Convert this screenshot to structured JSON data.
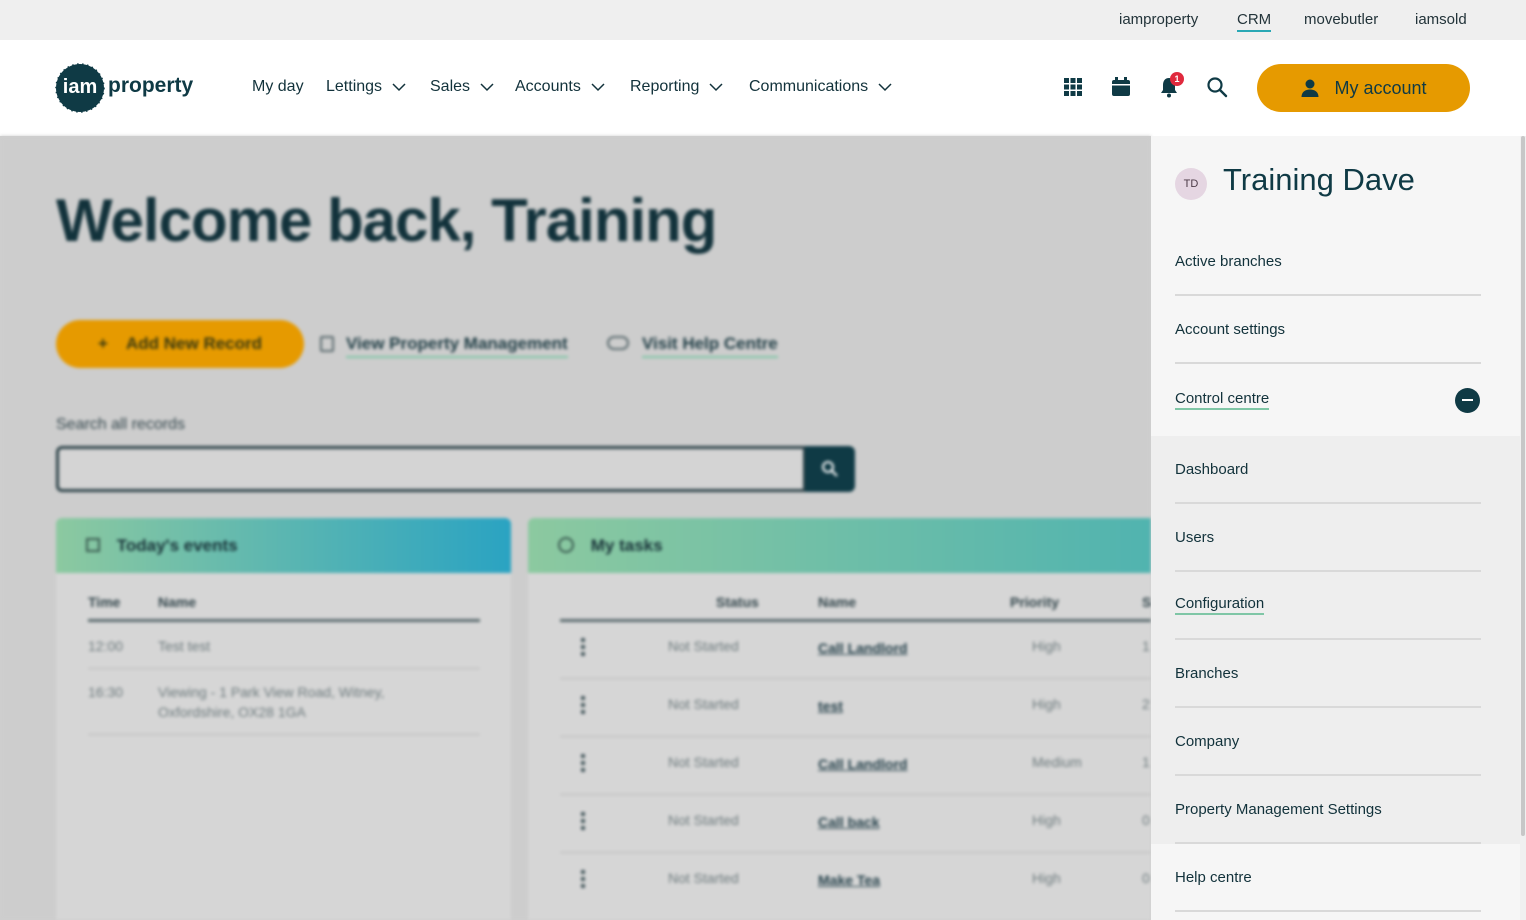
{
  "utility_links": [
    {
      "label": "iamproperty",
      "active": false
    },
    {
      "label": "CRM",
      "active": true
    },
    {
      "label": "movebutler",
      "active": false
    },
    {
      "label": "iamsold",
      "active": false
    }
  ],
  "logo": {
    "mark": "iam",
    "word": "property"
  },
  "nav": {
    "items": [
      {
        "label": "My day",
        "has_dropdown": false
      },
      {
        "label": "Lettings",
        "has_dropdown": true
      },
      {
        "label": "Sales",
        "has_dropdown": true
      },
      {
        "label": "Accounts",
        "has_dropdown": true
      },
      {
        "label": "Reporting",
        "has_dropdown": true
      },
      {
        "label": "Communications",
        "has_dropdown": true
      }
    ],
    "icons": [
      "apps-grid-icon",
      "calendar-icon",
      "bell-icon",
      "search-icon"
    ],
    "notification_count": "1",
    "account_label": "My account"
  },
  "welcome": {
    "title": "Welcome back, Training"
  },
  "actions": {
    "add_record": "Add New Record",
    "view_pm": "View Property Management",
    "help_centre": "Visit Help Centre"
  },
  "search": {
    "label": "Search all records",
    "placeholder": ""
  },
  "events": {
    "title": "Today's events",
    "columns": [
      "Time",
      "Name"
    ],
    "rows": [
      {
        "time": "12:00",
        "name": "Test test",
        "name2": ""
      },
      {
        "time": "16:30",
        "name": "Viewing - 1 Park View Road, Witney,",
        "name2": "Oxfordshire, OX28 1GA"
      }
    ]
  },
  "tasks": {
    "title": "My tasks",
    "columns": [
      "Status",
      "Name",
      "Priority",
      "S"
    ],
    "rows": [
      {
        "status": "Not Started",
        "name": "Call Landlord",
        "priority": "High",
        "extra": "1"
      },
      {
        "status": "Not Started",
        "name": "test",
        "priority": "High",
        "extra": "2"
      },
      {
        "status": "Not Started",
        "name": "Call Landlord",
        "priority": "Medium",
        "extra": "1"
      },
      {
        "status": "Not Started",
        "name": "Call back",
        "priority": "High",
        "extra": "0"
      },
      {
        "status": "Not Started",
        "name": "Make Tea",
        "priority": "High",
        "extra": "0"
      }
    ]
  },
  "account_menu": {
    "initials": "TD",
    "user_name": "Training Dave",
    "items": [
      "Active branches",
      "Account settings"
    ],
    "control_centre": "Control centre",
    "sub_items": [
      "Dashboard",
      "Users",
      "Configuration",
      "Branches",
      "Company",
      "Property Management Settings"
    ],
    "help_centre": "Help centre"
  },
  "colors": {
    "brand_dark": "#0f3a45",
    "accent_orange": "#e69a00",
    "badge_red": "#e0293d",
    "link_underline": "#7fc6a6"
  }
}
